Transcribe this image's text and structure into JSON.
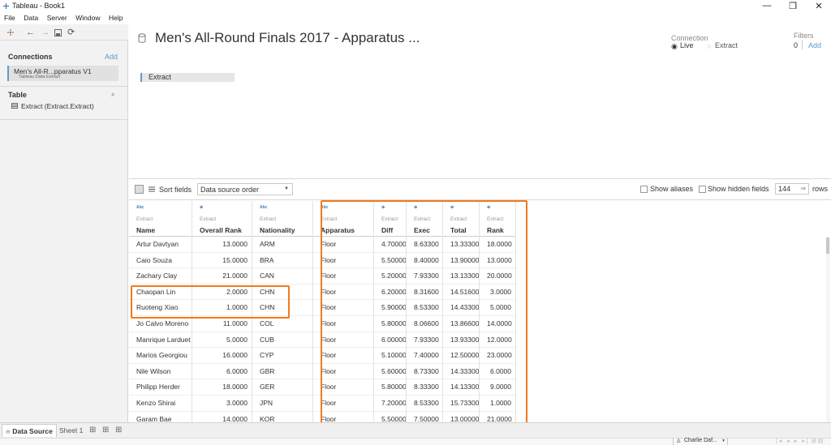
{
  "window": {
    "title": "Tableau - Book1",
    "minimize": "—",
    "maximize": "❐",
    "close": "✕"
  },
  "menu": [
    "File",
    "Data",
    "Server",
    "Window",
    "Help"
  ],
  "left_pane": {
    "connections_title": "Connections",
    "connections_add": "Add",
    "connection_name": "Men's All-R...pparatus V1",
    "connection_sub": "Tableau Data Extract",
    "table_title": "Table",
    "table_item": "Extract (Extract.Extract)"
  },
  "canvas": {
    "title": "Men's All-Round Finals 2017 - Apparatus ...",
    "connection_label": "Connection",
    "connection_live": "Live",
    "connection_extract": "Extract",
    "filters_label": "Filters",
    "filters_count": "0",
    "filters_add": "Add",
    "table_box": "Extract"
  },
  "grid_toolbar": {
    "sort_label": "Sort fields",
    "sort_value": "Data source order",
    "show_aliases": "Show aliases",
    "show_hidden": "Show hidden fields",
    "rows_value": "144",
    "rows_label": "rows"
  },
  "columns": [
    {
      "type_icon": "Abc",
      "source": "Extract",
      "name": "Name",
      "align": "left"
    },
    {
      "type_icon": "⊕",
      "source": "Extract",
      "name": "Overall Rank",
      "align": "right"
    },
    {
      "type_icon": "Abc",
      "source": "Extract",
      "name": "Nationality",
      "align": "left"
    },
    {
      "type_icon": "Abc",
      "source": "Extract",
      "name": "Apparatus",
      "align": "left"
    },
    {
      "type_icon": "⊕",
      "source": "Extract",
      "name": "Diff",
      "align": "right"
    },
    {
      "type_icon": "⊕",
      "source": "Extract",
      "name": "Exec",
      "align": "right"
    },
    {
      "type_icon": "⊕",
      "source": "Extract",
      "name": "Total",
      "align": "right"
    },
    {
      "type_icon": "⊕",
      "source": "Extract",
      "name": "Rank",
      "align": "right"
    }
  ],
  "rows": [
    [
      "Artur Davtyan",
      "13.0000",
      "ARM",
      "Floor",
      "4.70000",
      "8.63300",
      "13.33300",
      "18.0000"
    ],
    [
      "Caio Souza",
      "15.0000",
      "BRA",
      "Floor",
      "5.50000",
      "8.40000",
      "13.90000",
      "13.0000"
    ],
    [
      "Zachary Clay",
      "21.0000",
      "CAN",
      "Floor",
      "5.20000",
      "7.93300",
      "13.13300",
      "20.0000"
    ],
    [
      "Chaopan Lin",
      "2.0000",
      "CHN",
      "Floor",
      "6.20000",
      "8.31600",
      "14.51600",
      "3.0000"
    ],
    [
      "Ruoteng Xiao",
      "1.0000",
      "CHN",
      "Floor",
      "5.90000",
      "8.53300",
      "14.43300",
      "5.0000"
    ],
    [
      "Jo Calvo Moreno",
      "11.0000",
      "COL",
      "Floor",
      "5.80000",
      "8.06600",
      "13.86600",
      "14.0000"
    ],
    [
      "Manrique Larduet",
      "5.0000",
      "CUB",
      "Floor",
      "6.00000",
      "7.93300",
      "13.93300",
      "12.0000"
    ],
    [
      "Marios Georgiou",
      "16.0000",
      "CYP",
      "Floor",
      "5.10000",
      "7.40000",
      "12.50000",
      "23.0000"
    ],
    [
      "Nile Wilson",
      "6.0000",
      "GBR",
      "Floor",
      "5.60000",
      "8.73300",
      "14.33300",
      "6.0000"
    ],
    [
      "Philipp Herder",
      "18.0000",
      "GER",
      "Floor",
      "5.80000",
      "8.33300",
      "14.13300",
      "9.0000"
    ],
    [
      "Kenzo Shirai",
      "3.0000",
      "JPN",
      "Floor",
      "7.20000",
      "8.53300",
      "15.73300",
      "1.0000"
    ],
    [
      "Garam Bae",
      "14.0000",
      "KOR",
      "Floor",
      "5.50000",
      "7.50000",
      "13.00000",
      "21.0000"
    ]
  ],
  "bottom_tabs": {
    "data_source": "Data Source",
    "sheet1": "Sheet 1"
  },
  "status": {
    "user": "Charlie Daf..."
  },
  "colors": {
    "highlight": "#f07a1e",
    "accent": "#5b9bd5"
  }
}
